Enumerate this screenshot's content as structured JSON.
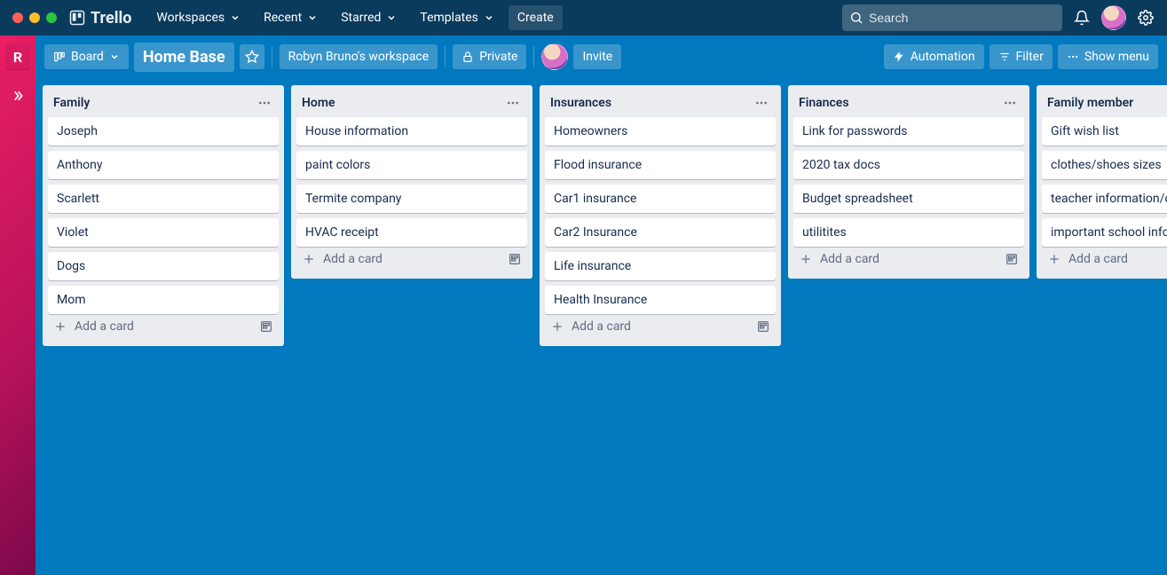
{
  "app": {
    "name": "Trello"
  },
  "nav": {
    "workspaces": "Workspaces",
    "recent": "Recent",
    "starred": "Starred",
    "templates": "Templates",
    "create": "Create"
  },
  "search": {
    "placeholder": "Search",
    "value": ""
  },
  "rail": {
    "initial": "R"
  },
  "board": {
    "view_label": "Board",
    "title": "Home Base",
    "workspace": "Robyn Bruno's workspace",
    "visibility": "Private",
    "invite": "Invite",
    "automation": "Automation",
    "filter": "Filter",
    "show_menu": "Show menu"
  },
  "add_card_label": "Add a card",
  "lists": [
    {
      "title": "Family",
      "cards": [
        "Joseph",
        "Anthony",
        "Scarlett",
        "Violet",
        "Dogs",
        "Mom"
      ]
    },
    {
      "title": "Home",
      "cards": [
        "House information",
        "paint colors",
        "Termite company",
        "HVAC receipt"
      ]
    },
    {
      "title": "Insurances",
      "cards": [
        "Homeowners",
        "Flood insurance",
        "Car1 insurance",
        "Car2 Insurance",
        "Life insurance",
        "Health Insurance"
      ]
    },
    {
      "title": "Finances",
      "cards": [
        "Link for passwords",
        "2020 tax docs",
        "Budget spreadsheet",
        "utilitites"
      ]
    },
    {
      "title": "Family member",
      "cards": [
        "Gift wish list",
        "clothes/shoes sizes",
        "teacher information/contact",
        "important school info"
      ]
    }
  ]
}
